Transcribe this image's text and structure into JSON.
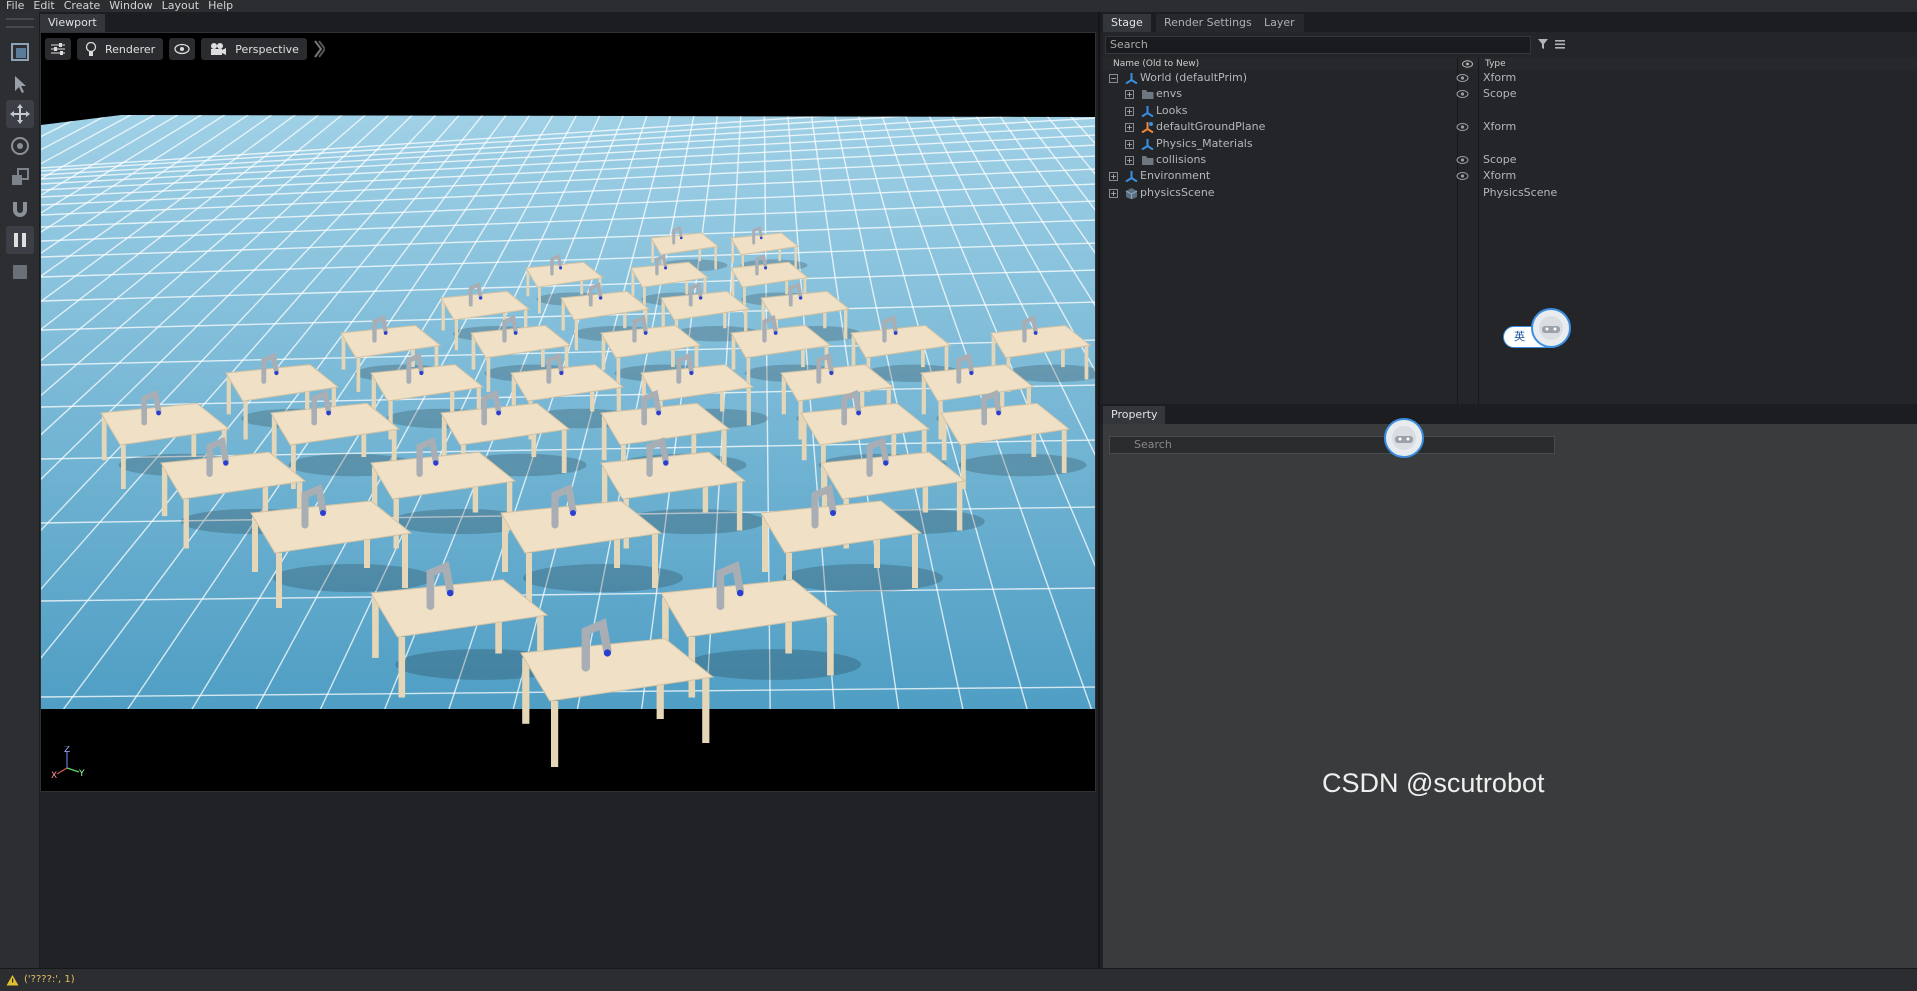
{
  "menu": [
    "File",
    "Edit",
    "Create",
    "Window",
    "Layout",
    "Help"
  ],
  "viewport": {
    "tab": "Viewport",
    "renderer_label": "Renderer",
    "camera_label": "Perspective",
    "axis": {
      "z": "Z",
      "x": "X",
      "y": "Y"
    }
  },
  "right_tabs": [
    "Stage",
    "Render Settings",
    "Layer"
  ],
  "stage": {
    "search_placeholder": "Search",
    "col_name": "Name (Old to New)",
    "col_type": "Type",
    "rows": [
      {
        "name": "World (defaultPrim)",
        "type": "Xform",
        "eye": true,
        "expanded": true,
        "icon": "xform-icon",
        "level": 0
      },
      {
        "name": "envs",
        "type": "Scope",
        "eye": true,
        "expanded": false,
        "icon": "folder-icon",
        "level": 1
      },
      {
        "name": "Looks",
        "type": "",
        "eye": false,
        "expanded": false,
        "icon": "xform-icon",
        "level": 1
      },
      {
        "name": "defaultGroundPlane",
        "type": "Xform",
        "eye": true,
        "expanded": false,
        "icon": "ground-plane-icon",
        "level": 1
      },
      {
        "name": "Physics_Materials",
        "type": "",
        "eye": false,
        "expanded": false,
        "icon": "xform-icon",
        "level": 1
      },
      {
        "name": "collisions",
        "type": "Scope",
        "eye": true,
        "expanded": false,
        "icon": "folder-icon",
        "level": 1
      },
      {
        "name": "Environment",
        "type": "Xform",
        "eye": true,
        "expanded": false,
        "icon": "xform-icon",
        "level": 0
      },
      {
        "name": "physicsScene",
        "type": "PhysicsScene",
        "eye": false,
        "expanded": false,
        "icon": "physics-scene-icon",
        "level": 0
      }
    ]
  },
  "property": {
    "tab": "Property",
    "search_placeholder": "Search"
  },
  "ime_label": "英",
  "watermark": "CSDN @scutrobot",
  "status": "('????:', 1)",
  "colors": {
    "panel": "#232529",
    "accent": "#3c8fe0",
    "sky": "#000000",
    "floor": "#6fb4d2"
  }
}
